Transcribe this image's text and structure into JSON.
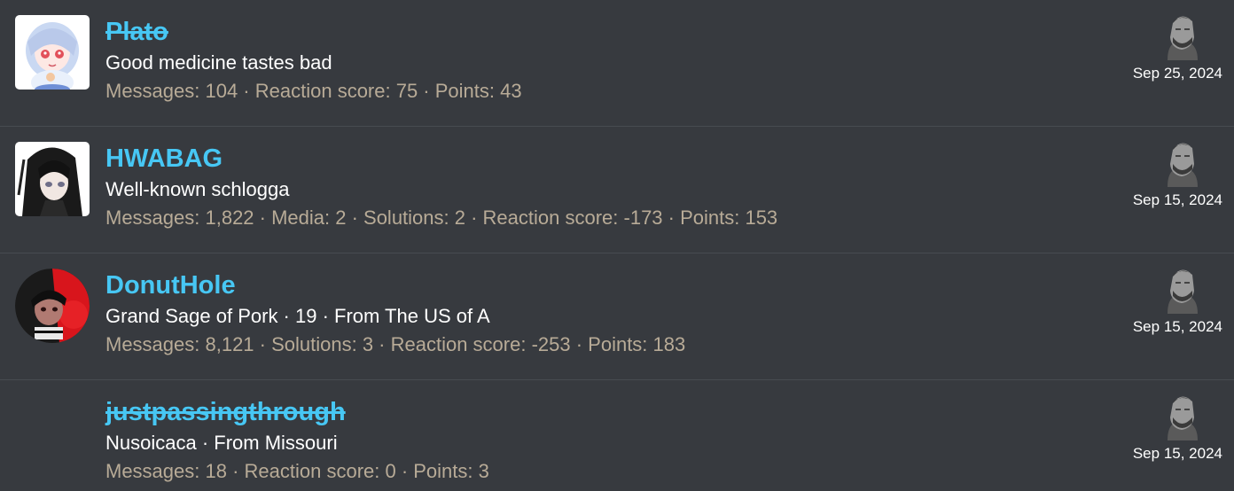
{
  "colors": {
    "background": "#373a3f",
    "username": "#47c7f4",
    "title": "#ffffff",
    "stats": "#b8ab97",
    "divider": "#474b51"
  },
  "members": [
    {
      "username": "Plato",
      "banned": true,
      "avatar_icon": "anime-girl-avatar",
      "title": "Good medicine tastes bad",
      "stats": "Messages: 104 · Reaction score: 75 · Points: 43",
      "date": "Sep 25, 2024",
      "right_icon": "gigachad-avatar"
    },
    {
      "username": "HWABAG",
      "banned": false,
      "avatar_icon": "dark-hair-anime-avatar",
      "title": "Well-known schlogga",
      "stats": "Messages: 1,822 · Media: 2 · Solutions: 2 · Reaction score: -173 · Points: 153",
      "date": "Sep 15, 2024",
      "right_icon": "gigachad-avatar"
    },
    {
      "username": "DonutHole",
      "banned": false,
      "avatar_icon": "red-black-anime-avatar",
      "title": "Grand Sage of Pork · 19 · From The US of A",
      "stats": "Messages: 8,121 · Solutions: 3 · Reaction score: -253 · Points: 183",
      "date": "Sep 15, 2024",
      "right_icon": "gigachad-avatar"
    },
    {
      "username": "justpassingthrough",
      "banned": true,
      "avatar_icon": "",
      "title": "Nusoicaca · From Missouri",
      "stats": "Messages: 18 · Reaction score: 0 · Points: 3",
      "date": "Sep 15, 2024",
      "right_icon": "gigachad-avatar"
    }
  ]
}
